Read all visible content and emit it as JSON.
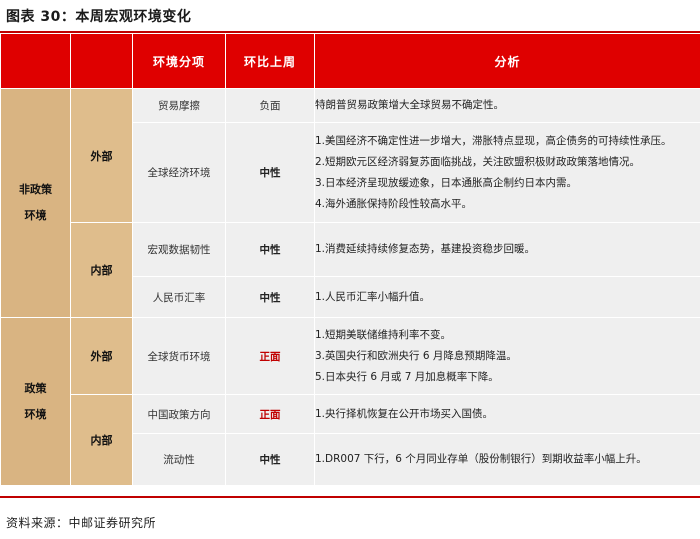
{
  "title": "图表 30：本周宏观环境变化",
  "header": {
    "col_factor": "环境分项",
    "col_change": "环比上周",
    "col_analysis": "分析"
  },
  "groups": [
    {
      "label_line1": "非政策",
      "label_line2": "环境"
    },
    {
      "label_line1": "政策",
      "label_line2": "环境"
    }
  ],
  "subgroups": [
    {
      "label": "外部"
    },
    {
      "label": "内部"
    },
    {
      "label": "外部"
    },
    {
      "label": "内部"
    }
  ],
  "rows": [
    {
      "factor": "贸易摩擦",
      "change": "负面",
      "analysis": [
        "特朗普贸易政策增大全球贸易不确定性。"
      ]
    },
    {
      "factor": "全球经济环境",
      "change": "中性",
      "analysis": [
        "1.美国经济不确定性进一步增大，滞胀特点显现，高企债务的可持续性承压。",
        "2.短期欧元区经济弱复苏面临挑战，关注欧盟积极财政政策落地情况。",
        "3.日本经济呈现放缓迹象，日本通胀高企制约日本内需。",
        "4.海外通胀保持阶段性较高水平。"
      ]
    },
    {
      "factor": "宏观数据韧性",
      "change": "中性",
      "analysis": [
        "1.消费延续持续修复态势，基建投资稳步回暖。"
      ]
    },
    {
      "factor": "人民币汇率",
      "change": "中性",
      "analysis": [
        "1.人民币汇率小幅升值。"
      ]
    },
    {
      "factor": "全球货币环境",
      "change": "正面",
      "analysis": [
        "1.短期美联储维持利率不变。",
        "3.英国央行和欧洲央行 6 月降息预期降温。",
        "5.日本央行 6 月或 7 月加息概率下降。"
      ]
    },
    {
      "factor": "中国政策方向",
      "change": "正面",
      "analysis": [
        "1.央行择机恢复在公开市场买入国债。"
      ]
    },
    {
      "factor": "流动性",
      "change": "中性",
      "analysis": [
        "1.DR007 下行，6 个月同业存单（股份制银行）到期收益率小幅上升。"
      ]
    }
  ],
  "source": "资料来源：中邮证券研究所",
  "colors": {
    "header_red": "#df0000",
    "rule_red": "#c00000",
    "gold": "#d9b482",
    "grey": "#efefef",
    "positive": "#c00000"
  }
}
